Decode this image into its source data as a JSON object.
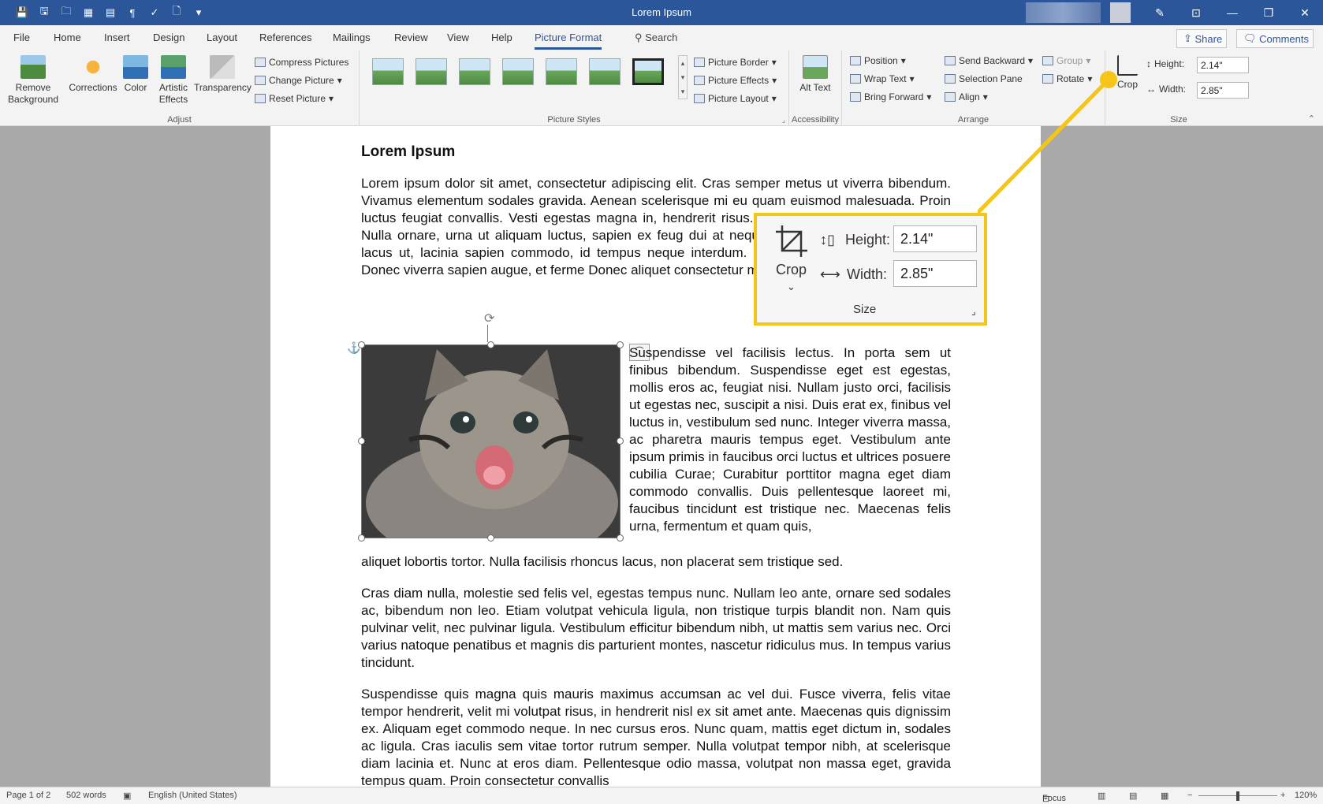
{
  "window": {
    "title": "Lorem Ipsum"
  },
  "tabs": [
    "File",
    "Home",
    "Insert",
    "Design",
    "Layout",
    "References",
    "Mailings",
    "Review",
    "View",
    "Help",
    "Picture Format"
  ],
  "active_tab": "Picture Format",
  "search_label": "Search",
  "share_label": "Share",
  "comments_label": "Comments",
  "ribbon": {
    "adjust": {
      "label": "Adjust",
      "remove_background": "Remove Background",
      "corrections": "Corrections",
      "color": "Color",
      "artistic_effects": "Artistic Effects",
      "transparency": "Transparency",
      "compress_pictures": "Compress Pictures",
      "change_picture": "Change Picture",
      "reset_picture": "Reset Picture"
    },
    "picture_styles": {
      "label": "Picture Styles",
      "picture_border": "Picture Border",
      "picture_effects": "Picture Effects",
      "picture_layout": "Picture Layout"
    },
    "accessibility": {
      "label": "Accessibility",
      "alt_text": "Alt Text"
    },
    "arrange": {
      "label": "Arrange",
      "position": "Position",
      "wrap_text": "Wrap Text",
      "bring_forward": "Bring Forward",
      "send_backward": "Send Backward",
      "selection_pane": "Selection Pane",
      "align": "Align",
      "group": "Group",
      "rotate": "Rotate"
    },
    "size": {
      "label": "Size",
      "crop": "Crop",
      "height_label": "Height:",
      "height_value": "2.14\"",
      "width_label": "Width:",
      "width_value": "2.85\""
    }
  },
  "document": {
    "title": "Lorem Ipsum",
    "p1": "Lorem ipsum dolor sit amet, consectetur adipiscing elit. Cras semper metus ut viverra bibendum. Vivamus elementum sodales gravida. Aenean scelerisque mi eu quam euismod malesuada. Proin luctus feugiat convallis. Vesti egestas magna in, hendrerit risus. Vivamus cursus enim a lacinia. Nulla ornare, urna ut aliquam luctus, sapien ex feug dui at neque. Cras ac nisl sodales, aliquet lacus ut, lacinia sapien commodo, id tempus neque interdum. In imperdie tristique elit tempor. Donec viverra sapien augue, et ferme Donec aliquet consectetur malesuada. Proin a lorem justo.",
    "p2_wrap": "Suspendisse vel facilisis lectus. In porta sem ut finibus bibendum. Suspendisse eget est egestas, mollis eros ac, feugiat nisi. Nullam justo orci, facilisis ut egestas nec, suscipit a nisi. Duis erat ex, finibus vel luctus in, vestibulum sed nunc. Integer viverra massa, ac pharetra mauris tempus eget. Vestibulum ante ipsum primis in faucibus orci luctus et ultrices posuere cubilia Curae; Curabitur porttitor magna eget diam commodo convallis. Duis pellentesque laoreet mi, faucibus tincidunt est tristique nec. Maecenas felis urna, fermentum et quam quis,",
    "p2_end": "aliquet lobortis tortor. Nulla facilisis rhoncus lacus, non placerat sem tristique sed.",
    "p3": "Cras diam nulla, molestie sed felis vel, egestas tempus nunc. Nullam leo ante, ornare sed sodales ac, bibendum non leo. Etiam volutpat vehicula ligula, non tristique turpis blandit non. Nam quis pulvinar velit, nec pulvinar ligula. Vestibulum efficitur bibendum nibh, ut mattis sem varius nec. Orci varius natoque penatibus et magnis dis parturient montes, nascetur ridiculus mus. In tempus varius tincidunt.",
    "p4": "Suspendisse quis magna quis mauris maximus accumsan ac vel dui. Fusce viverra, felis vitae tempor hendrerit, velit mi volutpat risus, in hendrerit nisl ex sit amet ante. Maecenas quis dignissim ex. Aliquam eget commodo neque. In nec cursus eros. Nunc quam, mattis eget dictum in, sodales ac ligula. Cras iaculis sem vitae tortor rutrum semper. Nulla volutpat tempor nibh, at scelerisque diam lacinia et. Nunc at eros diam. Pellentesque odio massa, volutpat non massa eget, gravida tempus quam. Proin consectetur convallis"
  },
  "callout": {
    "crop": "Crop",
    "height_label": "Height:",
    "height_value": "2.14\"",
    "width_label": "Width:",
    "width_value": "2.85\"",
    "group_label": "Size",
    "highlight_color": "#f5c518"
  },
  "status": {
    "page": "Page 1 of 2",
    "words": "502 words",
    "language": "English (United States)",
    "focus": "Focus",
    "zoom": "120%"
  },
  "colors": {
    "accent": "#2b579a",
    "callout": "#f5c518"
  }
}
